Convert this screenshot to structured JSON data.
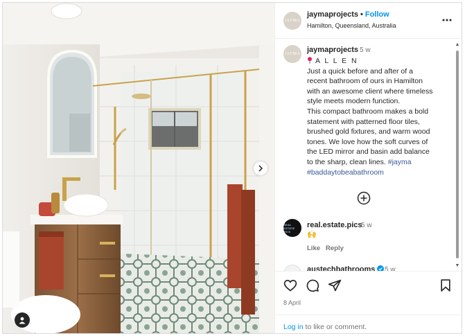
{
  "post": {
    "username": "jaymaprojects",
    "follow_label": "Follow",
    "separator": "•",
    "location": "Hamilton, Queensland, Australia",
    "avatar_text": "JAYMA"
  },
  "caption": {
    "username": "jaymaprojects",
    "time": "5 w",
    "heading": "A L L E N",
    "lines": [
      "Just a quick before and after of a",
      "recent bathroom of ours in Hamilton",
      "with an awesome client where timeless",
      "style meets modern function.",
      "This compact bathroom makes a bold",
      "statement with patterned floor tiles,",
      "brushed gold fixtures, and warm wood",
      "tones. We love how the soft curves of",
      "the LED mirror and basin add balance",
      "to the sharp, clean lines."
    ],
    "hashtag_1": "#jayma",
    "hashtag_2": "#baddaytobeabathroom"
  },
  "comments": [
    {
      "username": "real.estate.pics",
      "time": "5 w",
      "text": "🙌",
      "like_label": "Like",
      "reply_label": "Reply",
      "avatar_text": "REAL ESTATE PICS"
    },
    {
      "username": "austechbathrooms",
      "time": "5 w"
    }
  ],
  "footer": {
    "date": "8 April",
    "login_label": "Log in",
    "login_rest": " to like or comment."
  },
  "icons": {
    "more": "more-options-icon",
    "like": "heart-icon",
    "comment": "comment-icon",
    "share": "share-icon",
    "save": "bookmark-icon",
    "add": "add-comment-icon",
    "next": "chevron-right-icon",
    "tags": "user-tag-icon",
    "pin": "round-pushpin-icon",
    "verified": "verified-badge-icon"
  },
  "colors": {
    "accent": "#0095f6",
    "hashtag": "#385898",
    "muted": "#737373"
  }
}
